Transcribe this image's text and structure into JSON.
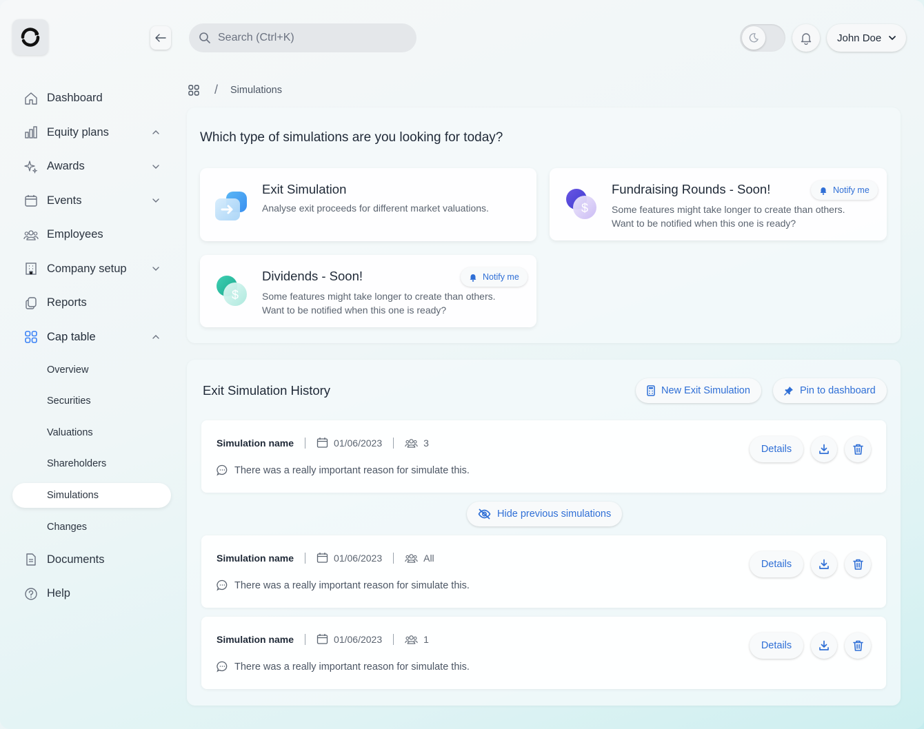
{
  "app": {
    "user_name": "John Doe",
    "search_placeholder": "Search (Ctrl+K)"
  },
  "sidebar": {
    "items": [
      {
        "label": "Dashboard",
        "icon": "home-icon"
      },
      {
        "label": "Equity plans",
        "icon": "bar-chart-icon",
        "expanded": true
      },
      {
        "label": "Awards",
        "icon": "sparkle-icon"
      },
      {
        "label": "Events",
        "icon": "calendar-icon"
      },
      {
        "label": "Employees",
        "icon": "users-icon"
      },
      {
        "label": "Company setup",
        "icon": "building-icon"
      },
      {
        "label": "Reports",
        "icon": "copy-icon"
      },
      {
        "label": "Cap table",
        "icon": "grid-icon",
        "expanded": true
      }
    ],
    "cap_table_sub": [
      "Overview",
      "Securities",
      "Valuations",
      "Shareholders",
      "Simulations",
      "Changes"
    ],
    "selected_sub": "Simulations",
    "bottom_items": [
      {
        "label": "Documents",
        "icon": "document-icon"
      },
      {
        "label": "Help",
        "icon": "help-icon"
      }
    ]
  },
  "breadcrumb": {
    "separator": "/",
    "current": "Simulations"
  },
  "types_panel": {
    "title": "Which type of simulations are you looking for today?",
    "notify_label": "Notify me",
    "cards": [
      {
        "title": "Exit Simulation",
        "desc": "Analyse exit proceeds for different market valuations."
      },
      {
        "title": "Fundraising Rounds - Soon!",
        "desc": "Some features might take longer to create than others. Want to be notified when this one is ready?"
      },
      {
        "title": "Dividends - Soon!",
        "desc": "Some features might take longer to create than others. Want to be notified when this one is ready?"
      }
    ]
  },
  "history": {
    "title": "Exit Simulation History",
    "new_label": "New Exit Simulation",
    "pin_label": "Pin to dashboard",
    "hide_label": "Hide previous simulations",
    "details_label": "Details",
    "rows": [
      {
        "name": "Simulation name",
        "date": "01/06/2023",
        "participants": "3",
        "reason": "There was a really important reason for simulate this."
      },
      {
        "name": "Simulation name",
        "date": "01/06/2023",
        "participants": "All",
        "reason": "There was a really important reason for simulate this."
      },
      {
        "name": "Simulation name",
        "date": "01/06/2023",
        "participants": "1",
        "reason": "There was a really important reason for simulate this."
      }
    ]
  },
  "colors": {
    "accent": "#2f6fd6",
    "cap_table_icon": "#3b82f6"
  }
}
